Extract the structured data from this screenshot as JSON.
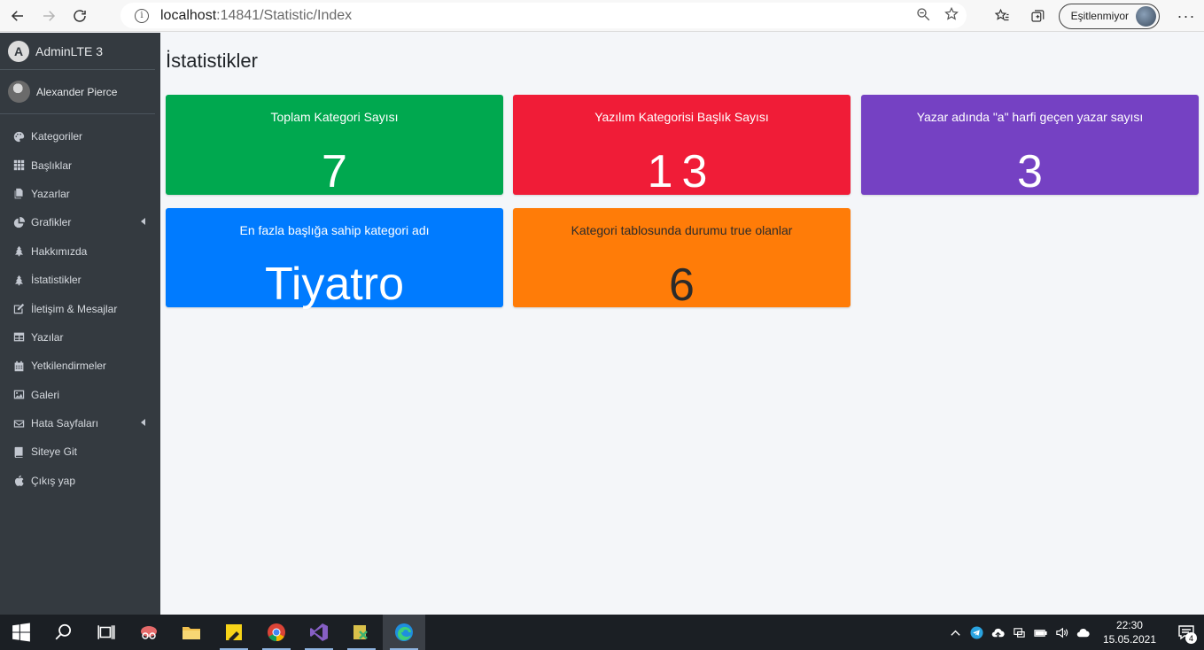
{
  "browser": {
    "url_host": "localhost",
    "url_path": ":14841/Statistic/Index",
    "sync_label": "Eşitlenmiyor"
  },
  "sidebar": {
    "brand": "AdminLTE 3",
    "user_name": "Alexander Pierce",
    "items": [
      {
        "label": "Kategoriler",
        "icon": "palette-icon"
      },
      {
        "label": "Başlıklar",
        "icon": "grid-icon"
      },
      {
        "label": "Yazarlar",
        "icon": "copy-icon"
      },
      {
        "label": "Grafikler",
        "icon": "pie-chart-icon"
      },
      {
        "label": "Hakkımızda",
        "icon": "tree-icon"
      },
      {
        "label": "İstatistikler",
        "icon": "tree-icon"
      },
      {
        "label": "İletişim & Mesajlar",
        "icon": "edit-icon"
      },
      {
        "label": "Yazılar",
        "icon": "table-icon"
      },
      {
        "label": "Yetkilendirmeler",
        "icon": "calendar-icon"
      },
      {
        "label": "Galeri",
        "icon": "image-icon"
      },
      {
        "label": "Hata Sayfaları",
        "icon": "envelope-icon"
      },
      {
        "label": "Siteye Git",
        "icon": "book-icon"
      },
      {
        "label": "Çıkış yap",
        "icon": "apple-icon"
      }
    ]
  },
  "main": {
    "title": "İstatistikler",
    "cards": [
      {
        "title": "Toplam Kategori Sayısı",
        "value": "7",
        "color": "#00a84f"
      },
      {
        "title": "Yazılım Kategorisi Başlık Sayısı",
        "value": "13",
        "color": "#f01c37"
      },
      {
        "title": "Yazar adında \"a\" harfi geçen yazar sayısı",
        "value": "3",
        "color": "#7541c3"
      },
      {
        "title": "En fazla başlığa sahip kategori adı",
        "value": "Tiyatro",
        "color": "#007bff"
      },
      {
        "title": "Kategori tablosunda durumu true olanlar",
        "value": "6",
        "color": "#ff7c08"
      }
    ]
  },
  "taskbar": {
    "time": "22:30",
    "date": "15.05.2021",
    "notifications": "4"
  }
}
